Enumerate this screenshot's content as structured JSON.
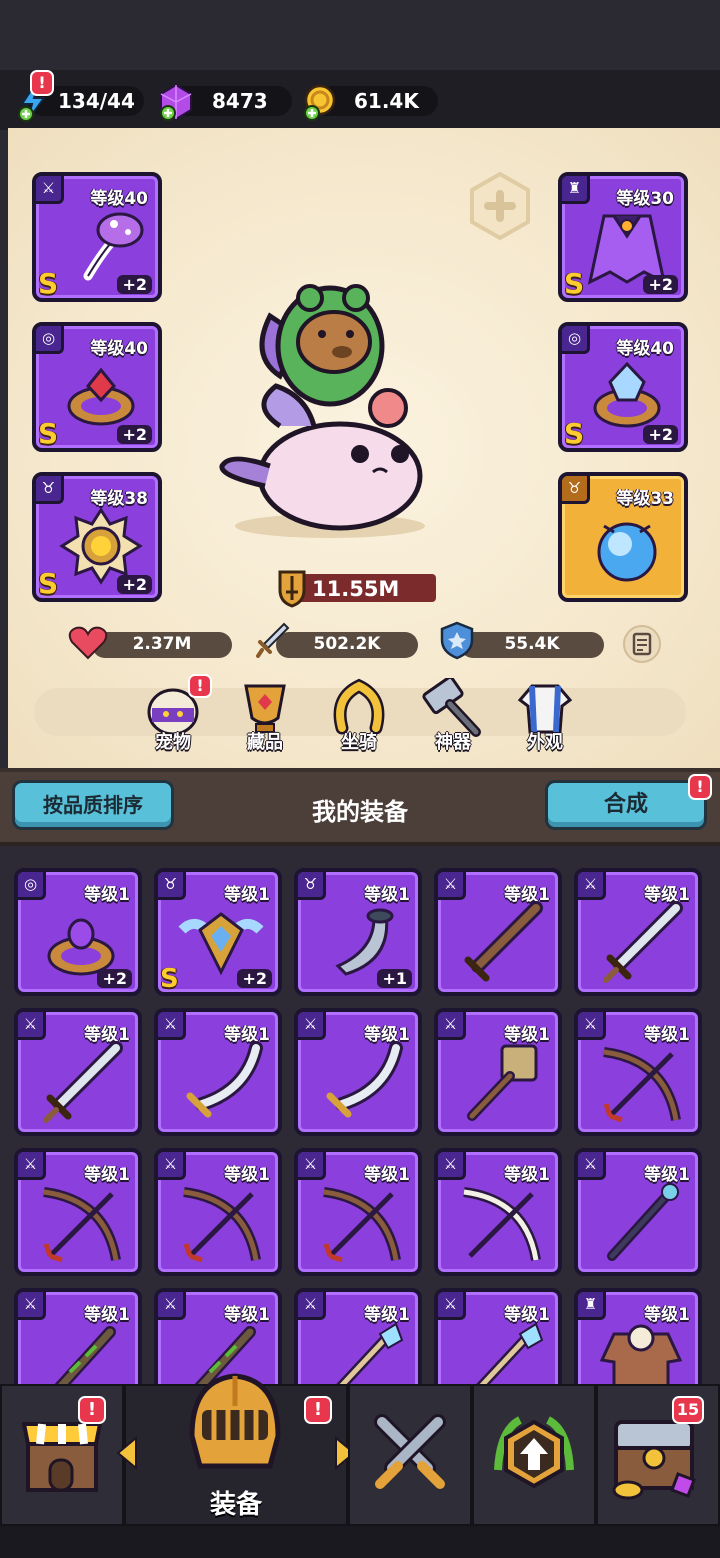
{
  "resources": {
    "energy": "134/44",
    "gems": "8473",
    "coins": "61.4K"
  },
  "equipped": {
    "left": [
      {
        "level": "等级40",
        "grade": "S",
        "plus": "+2",
        "tag": "sword-icon",
        "item": "mushroom-axe"
      },
      {
        "level": "等级40",
        "grade": "S",
        "plus": "+2",
        "tag": "ring-icon",
        "item": "ruby-ring"
      },
      {
        "level": "等级38",
        "grade": "S",
        "plus": "+2",
        "tag": "necklace-icon",
        "item": "sun-amulet"
      }
    ],
    "right": [
      {
        "level": "等级30",
        "grade": "S",
        "plus": "+2",
        "tag": "armor-icon",
        "item": "purple-cape"
      },
      {
        "level": "等级40",
        "grade": "S",
        "plus": "+2",
        "tag": "ring-icon",
        "item": "crystal-ring"
      },
      {
        "level": "等级33",
        "grade": "",
        "plus": "",
        "tag": "necklace-icon",
        "item": "ice-orb"
      }
    ]
  },
  "power": "11.55M",
  "stats": {
    "hp": "2.37M",
    "attack": "502.2K",
    "defense": "55.4K"
  },
  "menu": [
    {
      "label": "宠物",
      "icon": "pet-egg-icon",
      "badge": "!"
    },
    {
      "label": "藏品",
      "icon": "collection-trophy-icon",
      "badge": ""
    },
    {
      "label": "坐骑",
      "icon": "mount-horseshoe-icon",
      "badge": ""
    },
    {
      "label": "神器",
      "icon": "artifact-hammer-icon",
      "badge": ""
    },
    {
      "label": "外观",
      "icon": "outfit-icon",
      "badge": ""
    }
  ],
  "section": {
    "sort_label": "按品质排序",
    "title": "我的装备",
    "merge_label": "合成",
    "merge_badge": "!"
  },
  "inventory": [
    {
      "level": "等级1",
      "plus": "+2",
      "grade": "",
      "tag": "ring-icon",
      "item": "amethyst-ring"
    },
    {
      "level": "等级1",
      "plus": "+2",
      "grade": "S",
      "tag": "necklace-icon",
      "item": "winged-shield-amulet"
    },
    {
      "level": "等级1",
      "plus": "+1",
      "grade": "",
      "tag": "necklace-icon",
      "item": "horn"
    },
    {
      "level": "等级1",
      "plus": "",
      "grade": "",
      "tag": "sword-icon",
      "item": "wooden-sword"
    },
    {
      "level": "等级1",
      "plus": "",
      "grade": "",
      "tag": "sword-icon",
      "item": "steel-sword"
    },
    {
      "level": "等级1",
      "plus": "",
      "grade": "",
      "tag": "sword-icon",
      "item": "steel-sword"
    },
    {
      "level": "等级1",
      "plus": "",
      "grade": "",
      "tag": "sword-icon",
      "item": "scimitar"
    },
    {
      "level": "等级1",
      "plus": "",
      "grade": "",
      "tag": "sword-icon",
      "item": "scimitar"
    },
    {
      "level": "等级1",
      "plus": "",
      "grade": "",
      "tag": "sword-icon",
      "item": "hammer"
    },
    {
      "level": "等级1",
      "plus": "",
      "grade": "",
      "tag": "sword-icon",
      "item": "bow"
    },
    {
      "level": "等级1",
      "plus": "",
      "grade": "",
      "tag": "sword-icon",
      "item": "bow"
    },
    {
      "level": "等级1",
      "plus": "",
      "grade": "",
      "tag": "sword-icon",
      "item": "bow"
    },
    {
      "level": "等级1",
      "plus": "",
      "grade": "",
      "tag": "sword-icon",
      "item": "bow"
    },
    {
      "level": "等级1",
      "plus": "",
      "grade": "",
      "tag": "sword-icon",
      "item": "bone-bow"
    },
    {
      "level": "等级1",
      "plus": "",
      "grade": "",
      "tag": "sword-icon",
      "item": "staff"
    },
    {
      "level": "等级1",
      "plus": "",
      "grade": "",
      "tag": "sword-icon",
      "item": "wood-staff"
    },
    {
      "level": "等级1",
      "plus": "",
      "grade": "",
      "tag": "sword-icon",
      "item": "wood-staff"
    },
    {
      "level": "等级1",
      "plus": "",
      "grade": "",
      "tag": "sword-icon",
      "item": "ice-staff"
    },
    {
      "level": "等级1",
      "plus": "",
      "grade": "",
      "tag": "sword-icon",
      "item": "ice-staff"
    },
    {
      "level": "等级1",
      "plus": "",
      "grade": "",
      "tag": "armor-icon",
      "item": "leather-armor"
    }
  ],
  "nav": {
    "shop_badge": "!",
    "equip_label": "装备",
    "equip_badge": "!",
    "chest_badge": "15"
  },
  "colors": {
    "epic_purple": "#8b3fdc",
    "legendary_gold": "#f2b23a",
    "button_cyan": "#59c0d9",
    "badge_red": "#e8364c"
  }
}
